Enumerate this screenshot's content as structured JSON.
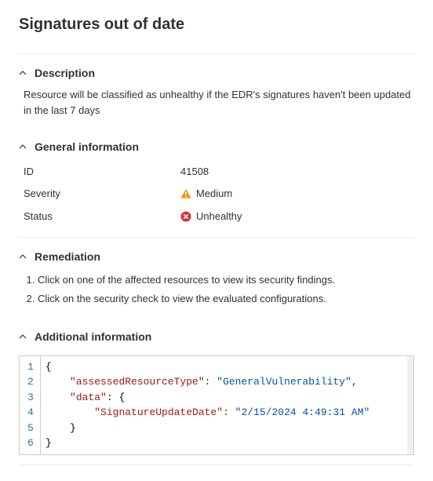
{
  "header": {
    "title": "Signatures out of date"
  },
  "sections": {
    "description": {
      "title": "Description",
      "text": "Resource will be classified as unhealthy if the EDR's signatures haven't been updated in the last 7 days"
    },
    "general": {
      "title": "General information",
      "rows": {
        "id": {
          "label": "ID",
          "value": "41508"
        },
        "severity": {
          "label": "Severity",
          "value": "Medium"
        },
        "status": {
          "label": "Status",
          "value": "Unhealthy"
        }
      }
    },
    "remediation": {
      "title": "Remediation",
      "steps": [
        "Click on one of the affected resources to view its security findings.",
        "Click on the security check to view the evaluated configurations."
      ]
    },
    "additional": {
      "title": "Additional information",
      "json_data": {
        "assessedResourceType": "GeneralVulnerability",
        "data": {
          "SignatureUpdateDate": "2/15/2024 4:49:31 AM"
        }
      },
      "code_lines": [
        "1",
        "2",
        "3",
        "4",
        "5",
        "6"
      ],
      "tokens": {
        "k1": "\"assessedResourceType\"",
        "v1": "\"GeneralVulnerability\"",
        "k2": "\"data\"",
        "k3": "\"SignatureUpdateDate\"",
        "v3": "\"2/15/2024 4:49:31 AM\""
      }
    }
  }
}
